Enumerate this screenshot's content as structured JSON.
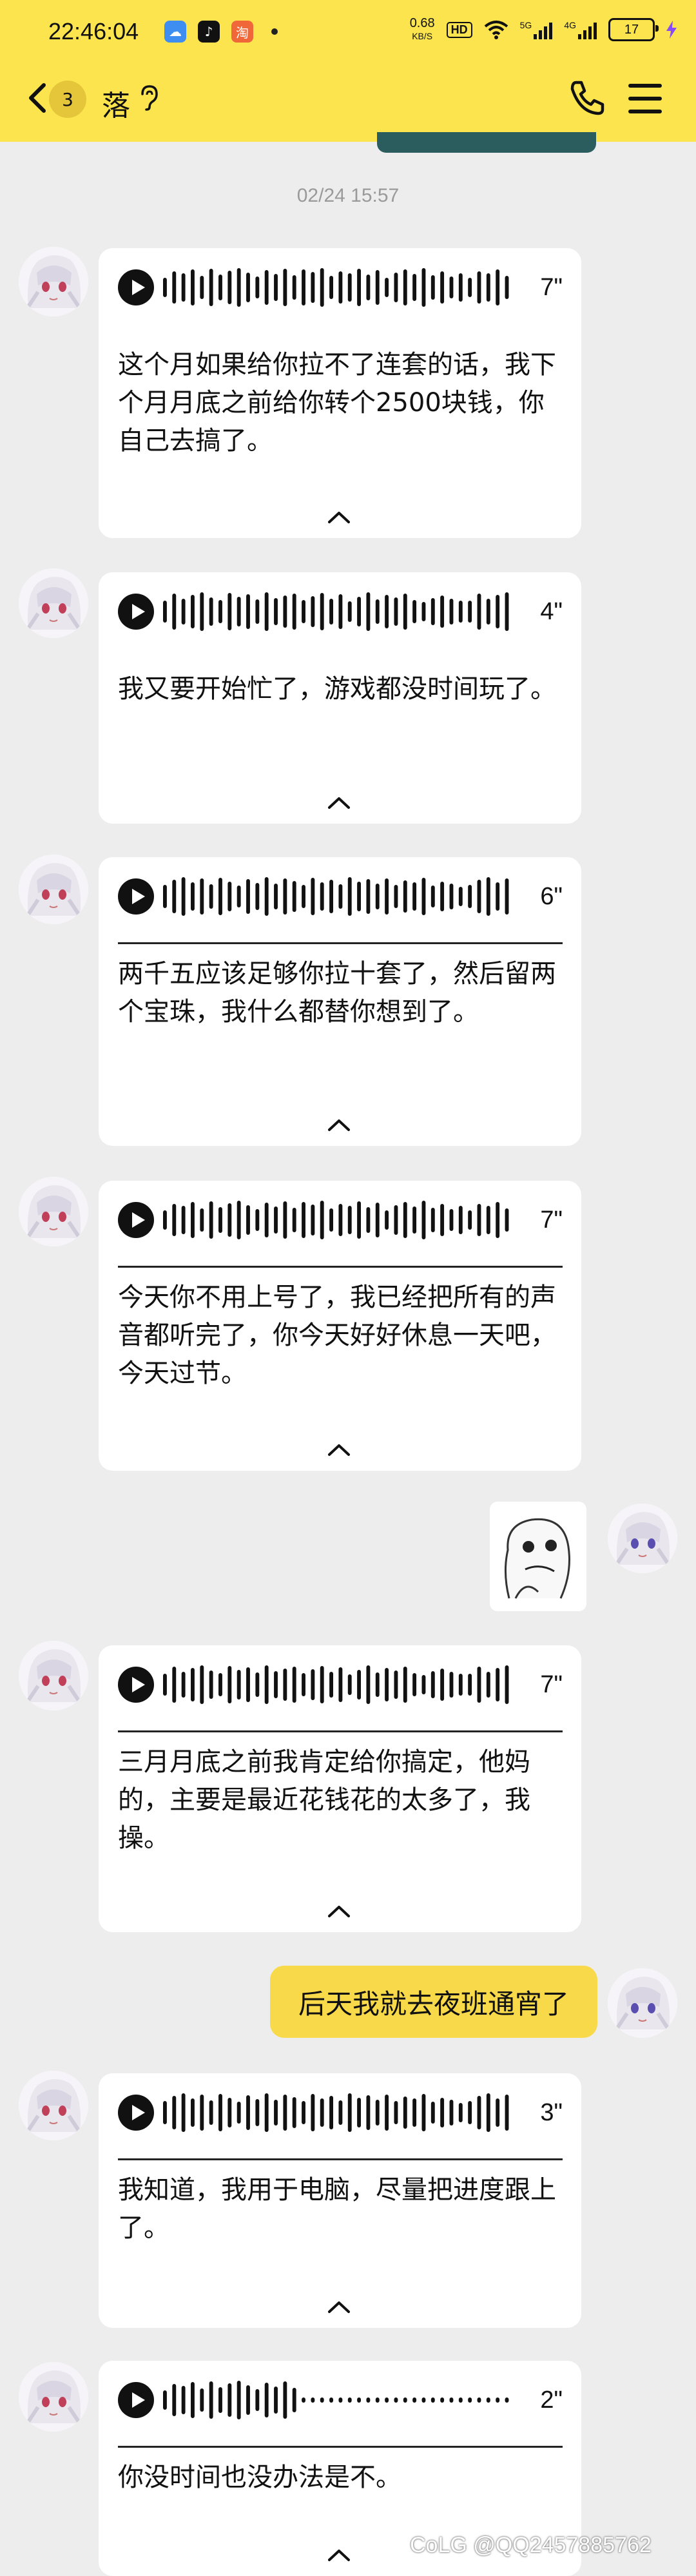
{
  "status_bar": {
    "time": "22:46:04",
    "net_speed": "0.68",
    "net_unit": "KB/S",
    "hd_label": "HD",
    "signal_1": "5G",
    "signal_2": "4G",
    "battery": "17",
    "app_icons": [
      "weather-app-icon",
      "tiktok-icon",
      "shopping-app-icon"
    ]
  },
  "header": {
    "unread_count": "3",
    "contact_name": "落",
    "icons": [
      "back-icon",
      "ear-icon",
      "phone-icon",
      "menu-icon"
    ]
  },
  "colors": {
    "header_bg": "#fbe44e",
    "my_bubble": "#f8d94a",
    "chat_bg": "#ededed"
  },
  "chat": {
    "timestamp": "02/24 15:57",
    "voice_messages": [
      {
        "duration": "7\"",
        "text": "这个月如果给你拉不了连套的话，我下个月月底之前给你转个2500块钱，你自己去搞了。"
      },
      {
        "duration": "4\"",
        "text": "我又要开始忙了，游戏都没时间玩了。"
      },
      {
        "duration": "6\"",
        "text": "两千五应该足够你拉十套了，然后留两个宝珠，我什么都替你想到了。"
      },
      {
        "duration": "7\"",
        "text": "今天你不用上号了，我已经把所有的声音都听完了，你今天好好休息一天吧，今天过节。"
      },
      {
        "duration": "7\"",
        "text": "三月月底之前我肯定给你搞定，他妈的，主要是最近花钱花的太多了，我操。"
      },
      {
        "duration": "3\"",
        "text": "我知道，我用于电脑，尽量把进度跟上了。"
      },
      {
        "duration": "2\"",
        "text": "你没时间也没办法是不。"
      }
    ],
    "my_message": "后天我就去夜班通宵了"
  },
  "watermark": "CoLG @QQ2457885762"
}
